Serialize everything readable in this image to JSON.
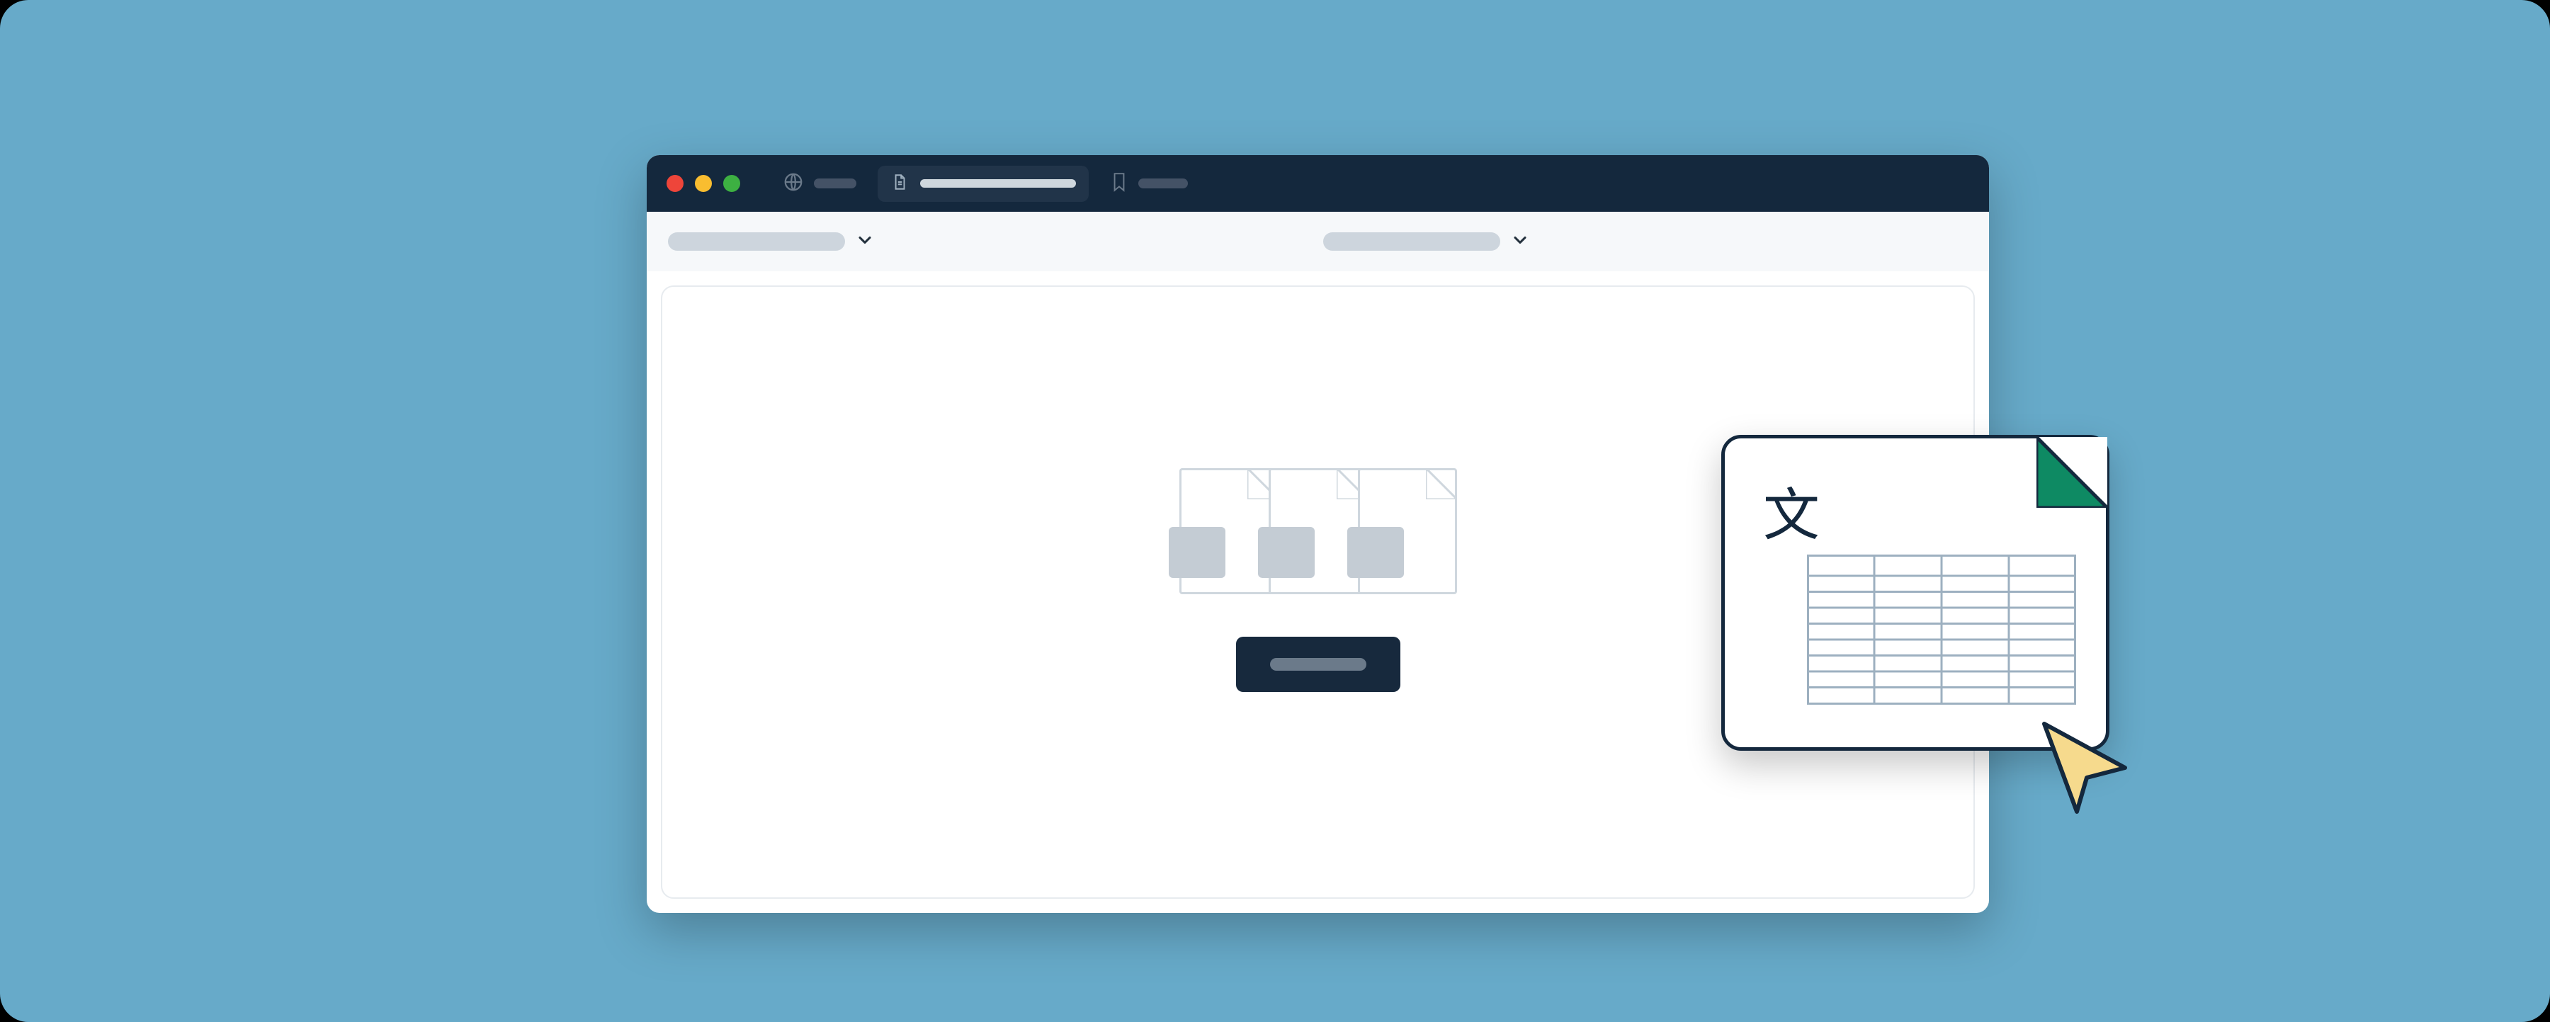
{
  "stage": {
    "background": "#67aac9"
  },
  "browser": {
    "titlebar": {
      "background": "#14283d",
      "lights": {
        "red": "#ee453a",
        "yellow": "#f9bd30",
        "green": "#3db042"
      },
      "globe_icon": "globe-icon",
      "page_icon": "page-icon",
      "bookmark_icon": "bookmark-icon"
    },
    "toolbar": {
      "dropdown_left": {
        "label": ""
      },
      "dropdown_right": {
        "label": ""
      }
    },
    "content": {
      "upload": {
        "file_placeholders": 3,
        "button_label": ""
      }
    }
  },
  "sheet_card": {
    "glyph": "文",
    "fold_color": "#0e8a63",
    "grid": {
      "cols": 4,
      "rows": 9
    }
  },
  "cursor": {
    "fill": "#f6da8d",
    "stroke": "#14283d"
  }
}
